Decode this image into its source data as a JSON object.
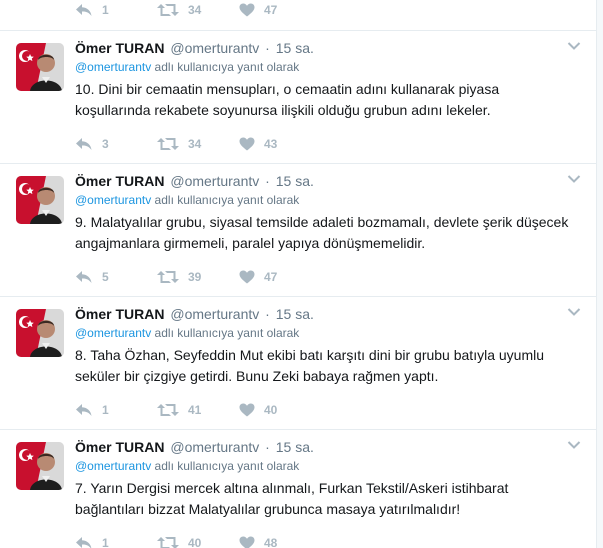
{
  "top_actions": {
    "reply_count": "1",
    "retweet_count": "34",
    "like_count": "47"
  },
  "tweets": [
    {
      "name": "Ömer TURAN",
      "handle": "@omerturantv",
      "dot": "·",
      "time": "15 sa.",
      "reply_mention": "@omerturantv",
      "reply_suffix": " adlı kullanıcıya yanıt olarak",
      "text": "10. Dini bir cemaatin mensupları, o cemaatin adını kullanarak piyasa koşullarında rekabete soyunursa ilişkili olduğu grubun adını lekeler.",
      "reply_count": "3",
      "retweet_count": "34",
      "like_count": "43"
    },
    {
      "name": "Ömer TURAN",
      "handle": "@omerturantv",
      "dot": "·",
      "time": "15 sa.",
      "reply_mention": "@omerturantv",
      "reply_suffix": " adlı kullanıcıya yanıt olarak",
      "text": "9. Malatyalılar grubu, siyasal temsilde adaleti bozmamalı, devlete şerik düşecek angajmanlara girmemeli, paralel yapıya dönüşmemelidir.",
      "reply_count": "5",
      "retweet_count": "39",
      "like_count": "47"
    },
    {
      "name": "Ömer TURAN",
      "handle": "@omerturantv",
      "dot": "·",
      "time": "15 sa.",
      "reply_mention": "@omerturantv",
      "reply_suffix": " adlı kullanıcıya yanıt olarak",
      "text": "8. Taha Özhan, Seyfeddin Mut ekibi batı karşıtı dini bir grubu batıyla uyumlu seküler bir çizgiye getirdi. Bunu Zeki babaya rağmen yaptı.",
      "reply_count": "1",
      "retweet_count": "41",
      "like_count": "40"
    },
    {
      "name": "Ömer TURAN",
      "handle": "@omerturantv",
      "dot": "·",
      "time": "15 sa.",
      "reply_mention": "@omerturantv",
      "reply_suffix": " adlı kullanıcıya yanıt olarak",
      "text": "7. Yarın Dergisi mercek altına alınmalı, Furkan Tekstil/Askeri istihbarat bağlantıları bizzat Malatyalılar grubunca masaya yatırılmalıdır!",
      "reply_count": "1",
      "retweet_count": "40",
      "like_count": "48"
    }
  ],
  "colors": {
    "text": "#14171a",
    "secondary": "#657786",
    "link": "#1b95e0",
    "action": "#aab8c2",
    "divider": "#e6ecf0"
  },
  "icons": {
    "reply": "reply-icon",
    "retweet": "retweet-icon",
    "like": "heart-icon",
    "menu": "chevron-down-icon",
    "avatar": "avatar"
  }
}
